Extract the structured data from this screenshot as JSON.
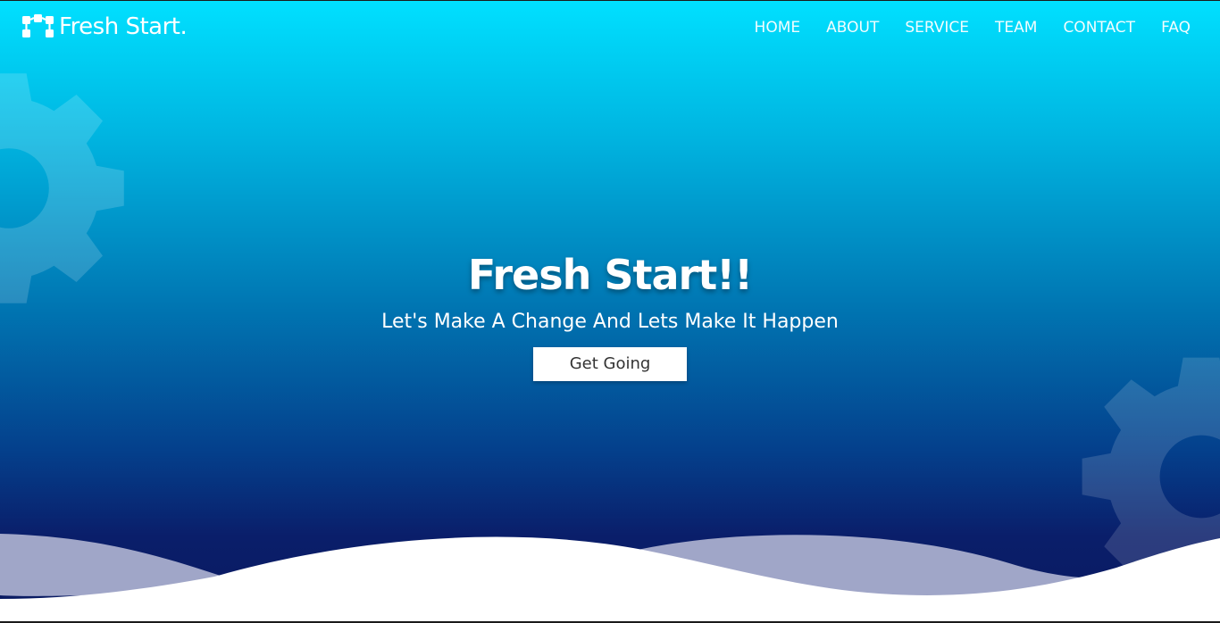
{
  "nav": {
    "brand": {
      "name": "Fresh Start.",
      "icon": "sitemap-icon"
    },
    "links": [
      {
        "label": "HOME"
      },
      {
        "label": "ABOUT"
      },
      {
        "label": "SERVICE"
      },
      {
        "label": "TEAM"
      },
      {
        "label": "CONTACT"
      },
      {
        "label": "FAQ"
      }
    ]
  },
  "hero": {
    "title": "Fresh Start!!",
    "subtitle": "Let's Make A Change And Lets Make It Happen",
    "cta_label": "Get Going",
    "decorations": [
      "gear-icon",
      "gear-icon"
    ]
  },
  "colors": {
    "gradient_top": "#00e0ff",
    "gradient_mid": "#0078b4",
    "gradient_bottom": "#0a1a60",
    "wave_back": "#a0a6c8",
    "wave_front": "#ffffff",
    "text": "#ffffff"
  }
}
